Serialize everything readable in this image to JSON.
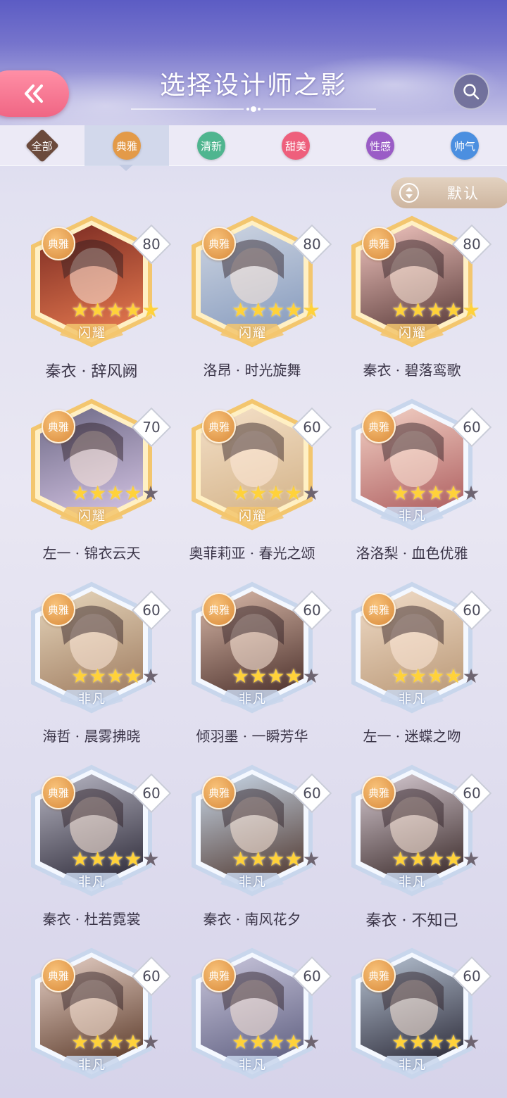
{
  "header": {
    "title": "选择设计师之影",
    "back_icon": "double-chevron-left-icon",
    "search_icon": "search-icon",
    "accent_pink": "#f06684"
  },
  "tabs": [
    {
      "label": "全部",
      "color": "#6b4a3c",
      "active": false
    },
    {
      "label": "典雅",
      "color": "#e39a48",
      "active": true
    },
    {
      "label": "清新",
      "color": "#4fb58f",
      "active": false
    },
    {
      "label": "甜美",
      "color": "#ee5f7c",
      "active": false
    },
    {
      "label": "性感",
      "color": "#9a5cc6",
      "active": false
    },
    {
      "label": "帅气",
      "color": "#4b8fe0",
      "active": false
    }
  ],
  "sort": {
    "label": "默认",
    "icon": "sort-toggle-icon"
  },
  "cards": [
    {
      "name": "秦衣 · 辞风阙",
      "style": "典雅",
      "level": "80",
      "stars": 5,
      "rarity": "闪耀"
    },
    {
      "name": "洛昂 · 时光旋舞",
      "style": "典雅",
      "level": "80",
      "stars": 5,
      "rarity": "闪耀"
    },
    {
      "name": "秦衣 · 碧落鸾歌",
      "style": "典雅",
      "level": "80",
      "stars": 5,
      "rarity": "闪耀"
    },
    {
      "name": "左一 · 锦衣云天",
      "style": "典雅",
      "level": "70",
      "stars": 4,
      "rarity": "闪耀"
    },
    {
      "name": "奥菲莉亚 · 春光之颂",
      "style": "典雅",
      "level": "60",
      "stars": 4,
      "rarity": "闪耀"
    },
    {
      "name": "洛洛梨 · 血色优雅",
      "style": "典雅",
      "level": "60",
      "stars": 4,
      "rarity": "非凡"
    },
    {
      "name": "海哲 · 晨雾拂晓",
      "style": "典雅",
      "level": "60",
      "stars": 4,
      "rarity": "非凡"
    },
    {
      "name": "倾羽墨 · 一瞬芳华",
      "style": "典雅",
      "level": "60",
      "stars": 4,
      "rarity": "非凡"
    },
    {
      "name": "左一 · 迷蝶之吻",
      "style": "典雅",
      "level": "60",
      "stars": 4,
      "rarity": "非凡"
    },
    {
      "name": "秦衣 · 杜若霓裳",
      "style": "典雅",
      "level": "60",
      "stars": 4,
      "rarity": "非凡"
    },
    {
      "name": "秦衣 · 南风花夕",
      "style": "典雅",
      "level": "60",
      "stars": 4,
      "rarity": "非凡"
    },
    {
      "name": "秦衣 · 不知己",
      "style": "典雅",
      "level": "60",
      "stars": 4,
      "rarity": "非凡"
    },
    {
      "name": "",
      "style": "典雅",
      "level": "60",
      "stars": 4,
      "rarity": "非凡"
    },
    {
      "name": "",
      "style": "典雅",
      "level": "60",
      "stars": 4,
      "rarity": "非凡"
    },
    {
      "name": "",
      "style": "典雅",
      "level": "60",
      "stars": 4,
      "rarity": "非凡"
    }
  ]
}
